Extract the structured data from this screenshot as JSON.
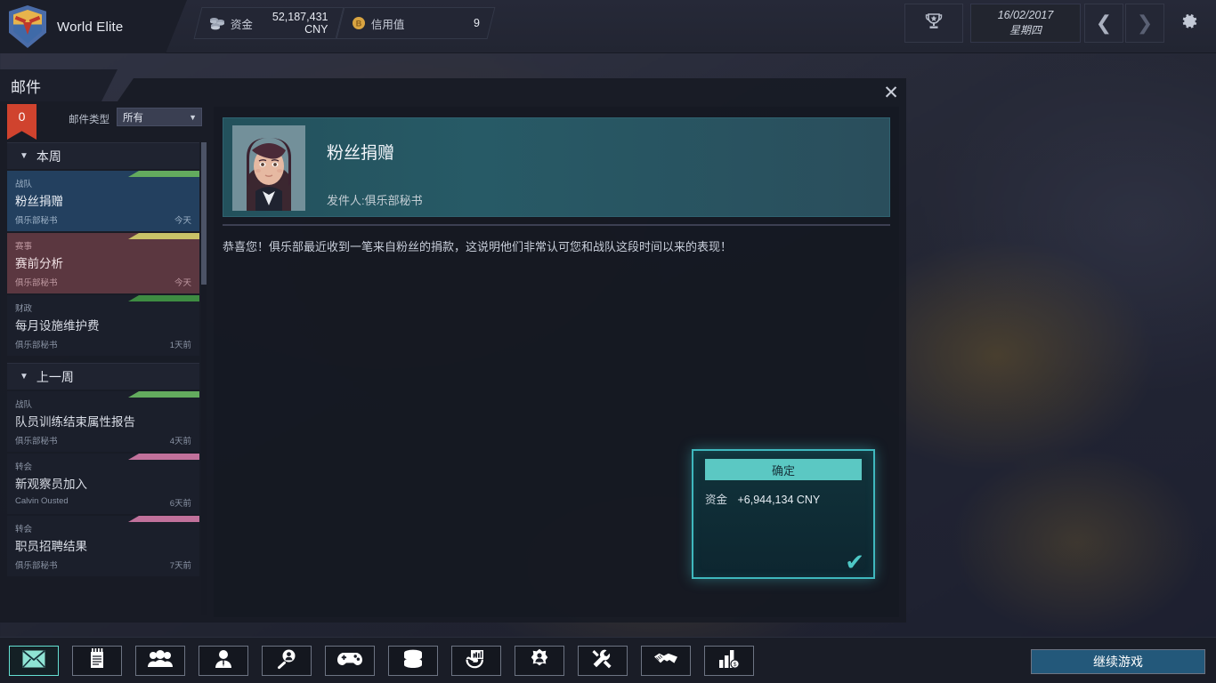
{
  "topbar": {
    "club_name": "World Elite",
    "club_crest_icon": "shield-crest-icon",
    "money": {
      "icon": "coins-icon",
      "label": "资金",
      "value": "52,187,431",
      "currency": "CNY"
    },
    "credit": {
      "icon": "bitcoin-icon",
      "label": "信用值",
      "value": "9"
    },
    "trophy_icon": "trophy-icon",
    "date": {
      "date": "16/02/2017",
      "weekday": "星期四"
    },
    "prev_icon": "chevron-left-icon",
    "next_icon": "chevron-right-icon",
    "gear_icon": "gear-icon"
  },
  "window": {
    "title": "邮件",
    "close_icon": "close-icon"
  },
  "filter": {
    "unread_count": "0",
    "label": "邮件类型",
    "selected": "所有",
    "caret_icon": "chevron-down-icon"
  },
  "mail_groups": [
    {
      "name": "本周",
      "tri_icon": "triangle-down-icon",
      "items": [
        {
          "category": "战队",
          "subject": "粉丝捐赠",
          "from": "俱乐部秘书",
          "when": "今天",
          "tag_color": "#63ab5e",
          "state": "selected-blue"
        },
        {
          "category": "赛事",
          "subject": "赛前分析",
          "from": "俱乐部秘书",
          "when": "今天",
          "tag_color": "#c9c267",
          "state": "selected-red"
        },
        {
          "category": "财政",
          "subject": "每月设施维护费",
          "from": "俱乐部秘书",
          "when": "1天前",
          "tag_color": "#3e8c42",
          "state": "normal"
        }
      ]
    },
    {
      "name": "上一周",
      "tri_icon": "triangle-down-icon",
      "items": [
        {
          "category": "战队",
          "subject": "队员训练结束属性报告",
          "from": "俱乐部秘书",
          "when": "4天前",
          "tag_color": "#63ab5e",
          "state": "normal"
        },
        {
          "category": "转会",
          "subject": "新观察员加入",
          "from": "Calvin Ousted",
          "when": "6天前",
          "tag_color": "#c1719b",
          "state": "normal"
        },
        {
          "category": "转会",
          "subject": "职员招聘结果",
          "from": "俱乐部秘书",
          "when": "7天前",
          "tag_color": "#c1719b",
          "state": "normal"
        }
      ]
    }
  ],
  "reading": {
    "avatar_name": "secretary-avatar",
    "subject": "粉丝捐赠",
    "sender": "发件人:俱乐部秘书",
    "body": "恭喜您！俱乐部最近收到一笔来自粉丝的捐款，这说明他们非常认可您和战队这段时间以来的表现！"
  },
  "reward": {
    "confirm_label": "确定",
    "line_label": "资金",
    "line_value": "+6,944,134 CNY",
    "check_icon": "check-icon"
  },
  "bottom_nav": [
    {
      "name": "mail",
      "icon": "envelope-icon",
      "active": true
    },
    {
      "name": "news",
      "icon": "notepad-icon",
      "active": false
    },
    {
      "name": "squad",
      "icon": "people-group-icon",
      "active": false
    },
    {
      "name": "player",
      "icon": "person-tie-icon",
      "active": false
    },
    {
      "name": "scouting",
      "icon": "magnifier-person-icon",
      "active": false
    },
    {
      "name": "match",
      "icon": "gamepad-icon",
      "active": false
    },
    {
      "name": "database",
      "icon": "database-icon",
      "active": false
    },
    {
      "name": "finance",
      "icon": "money-hand-icon",
      "active": false
    },
    {
      "name": "training",
      "icon": "target-person-icon",
      "active": false
    },
    {
      "name": "facilities",
      "icon": "tools-icon",
      "active": false
    },
    {
      "name": "sponsors",
      "icon": "handshake-icon",
      "active": false
    },
    {
      "name": "statistics",
      "icon": "bar-chart-money-icon",
      "active": false
    }
  ],
  "continue": {
    "label": "继续游戏"
  },
  "colors": {
    "accent_cyan": "#5bc8c3",
    "unread_badge": "#d0432e",
    "header_teal": "#275a66",
    "continue_blue": "#23587a"
  }
}
